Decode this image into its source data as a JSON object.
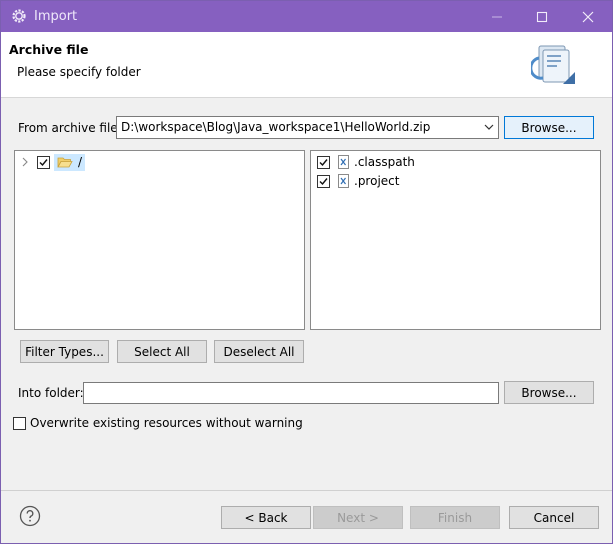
{
  "window": {
    "title": "Import"
  },
  "header": {
    "title": "Archive file",
    "description": "Please specify folder"
  },
  "archive": {
    "label": "From archive file:",
    "path": "D:\\workspace\\Blog\\Java_workspace1\\HelloWorld.zip",
    "browse_label": "Browse..."
  },
  "tree": {
    "root_label": "/"
  },
  "files": [
    {
      "name": ".classpath",
      "checked": true
    },
    {
      "name": ".project",
      "checked": true
    }
  ],
  "buttons": {
    "filter_types": "Filter Types...",
    "select_all": "Select All",
    "deselect_all": "Deselect All"
  },
  "into_folder": {
    "label": "Into folder:",
    "value": "",
    "browse_label": "Browse..."
  },
  "overwrite": {
    "label": "Overwrite existing resources without warning",
    "checked": false
  },
  "footer": {
    "back": "< Back",
    "next": "Next >",
    "finish": "Finish",
    "cancel": "Cancel"
  },
  "colors": {
    "titlebar": "#8660c0",
    "focus": "#0078d7"
  },
  "icons": [
    "gear-icon",
    "minimize-icon",
    "maximize-icon",
    "close-icon",
    "wizard-import-icon",
    "folder-open-icon",
    "xml-file-icon",
    "help-icon",
    "chevron-down-icon",
    "tree-expand-icon"
  ]
}
